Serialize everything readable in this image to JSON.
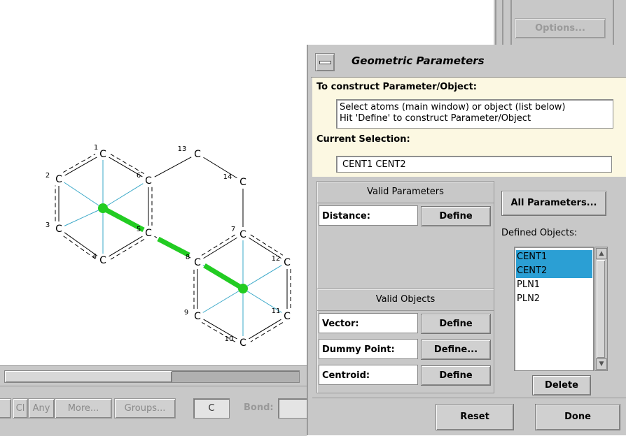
{
  "molecule": {
    "atom_symbol": "C",
    "atoms": [
      {
        "num": "1",
        "symbol": "C"
      },
      {
        "num": "2",
        "symbol": "C"
      },
      {
        "num": "3",
        "symbol": "C"
      },
      {
        "num": "4",
        "symbol": "C"
      },
      {
        "num": "5",
        "symbol": "C"
      },
      {
        "num": "6",
        "symbol": "C"
      },
      {
        "num": "7",
        "symbol": "C"
      },
      {
        "num": "8",
        "symbol": "C"
      },
      {
        "num": "9",
        "symbol": "C"
      },
      {
        "num": "10",
        "symbol": "C"
      },
      {
        "num": "11",
        "symbol": "C"
      },
      {
        "num": "12",
        "symbol": "C"
      },
      {
        "num": "13",
        "symbol": "C"
      },
      {
        "num": "14",
        "symbol": "C"
      }
    ],
    "colors": {
      "bond": "#000000",
      "centroid_spoke": "#3aa8c8",
      "selection": "#22cc22"
    }
  },
  "main_toolbar": {
    "cl_label": "Cl",
    "any_label": "Any",
    "more_label": "More...",
    "groups_label": "Groups...",
    "element_value": "C",
    "bond_label": "Bond:"
  },
  "background_window": {
    "options_label": "Options..."
  },
  "dialog": {
    "title": "Geometric Parameters",
    "construct_label": "To construct Parameter/Object:",
    "instructions_line1": "Select atoms (main window) or object (list below)",
    "instructions_line2": "Hit 'Define' to construct Parameter/Object",
    "current_selection_label": "Current Selection:",
    "current_selection_value": "CENT1 CENT2",
    "valid_parameters_heading": "Valid Parameters",
    "parameters": [
      {
        "label": "Distance:",
        "button": "Define"
      }
    ],
    "valid_objects_heading": "Valid Objects",
    "objects": [
      {
        "label": "Vector:",
        "button": "Define"
      },
      {
        "label": "Dummy Point:",
        "button": "Define..."
      },
      {
        "label": "Centroid:",
        "button": "Define"
      }
    ],
    "all_parameters_label": "All Parameters...",
    "defined_objects_label": "Defined Objects:",
    "defined_objects": [
      {
        "name": "CENT1",
        "selected": true
      },
      {
        "name": "CENT2",
        "selected": true
      },
      {
        "name": "PLN1",
        "selected": false
      },
      {
        "name": "PLN2",
        "selected": false
      }
    ],
    "delete_label": "Delete",
    "reset_label": "Reset",
    "done_label": "Done",
    "colors": {
      "info_background": "#fcf8e2",
      "list_selection": "#2b9fd4"
    }
  }
}
